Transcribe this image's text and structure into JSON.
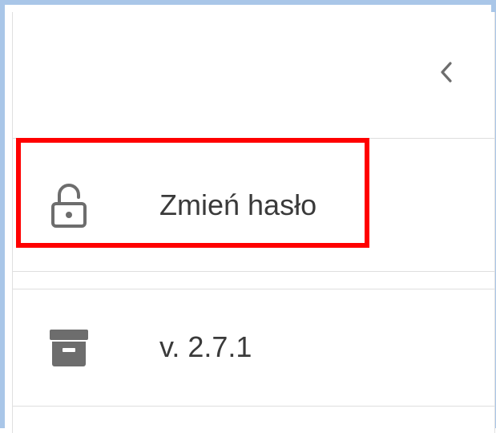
{
  "header": {
    "collapse_icon": "chevron-left-icon"
  },
  "menu": {
    "items": [
      {
        "label": "Zmień hasło",
        "icon": "lock-open-icon"
      },
      {
        "label": "v. 2.7.1",
        "icon": "archive-box-icon"
      }
    ]
  },
  "colors": {
    "highlight": "#ff0000",
    "frame": "#a9c6e8",
    "icon": "#6d6d6d",
    "text": "#3a3a3a",
    "divider": "#dedede"
  }
}
